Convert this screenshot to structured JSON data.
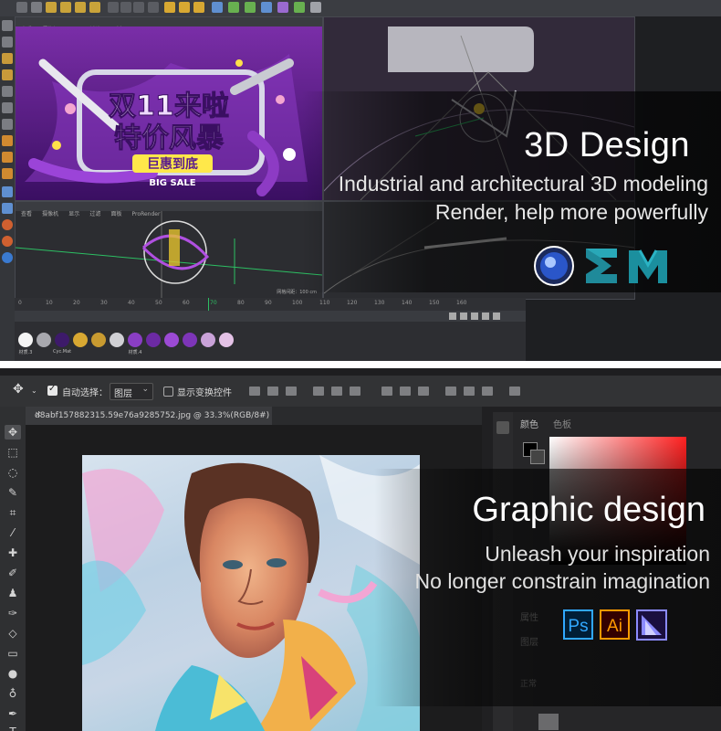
{
  "c4d": {
    "title": "3D Design",
    "subtitle_line1": "Industrial and architectural 3D modeling",
    "subtitle_line2": "Render, help more powerfully",
    "viewport_menu": [
      "查看",
      "摄像机",
      "显示",
      "过滤",
      "面板",
      "ProRender"
    ],
    "poster_line1": "双11来啦",
    "poster_line2": "特价风暴",
    "poster_line3": "巨惠到底",
    "poster_line4": "BIG SALE",
    "timeline_ticks": [
      "0",
      "10",
      "20",
      "30",
      "40",
      "50",
      "60",
      "70",
      "80",
      "90",
      "100",
      "110",
      "120",
      "130",
      "140",
      "150",
      "160"
    ],
    "scale_label": "网格间距：100 cm",
    "material_labels": [
      "材质.3",
      "Cyc.Mat",
      "材质",
      "材质",
      "材质",
      "材质.4",
      "材质",
      "材质",
      "材质",
      "材质",
      "材质",
      "材质"
    ],
    "icons": [
      "cinema4d-icon",
      "3dsmax-icon",
      "maya-icon"
    ]
  },
  "ps": {
    "title": "Graphic design",
    "subtitle_line1": "Unleash your inspiration",
    "subtitle_line2": "No longer constrain imagination",
    "auto_select_label": "自动选择：",
    "auto_select_value": "图层",
    "show_transform_label": "显示变换控件",
    "tab_name": "d8abf157882315.59e76a9285752.jpg @ 33.3%(RGB/8#)",
    "panel_color_label": "颜色",
    "panel_swatch_label": "色板",
    "panel_properties_label": "属性",
    "panel_layers_label": "图层",
    "panel_normal_label": "正常",
    "badges": [
      "Ps",
      "Ai"
    ]
  },
  "colors": {
    "ps_badge_fg": "#31a8ff",
    "ps_badge_bg": "#001e36",
    "ai_badge_fg": "#ff9a00",
    "ai_badge_bg": "#330000",
    "premiere_blue": "#2f6fdb",
    "purple_poster": "#5a1d8c"
  }
}
